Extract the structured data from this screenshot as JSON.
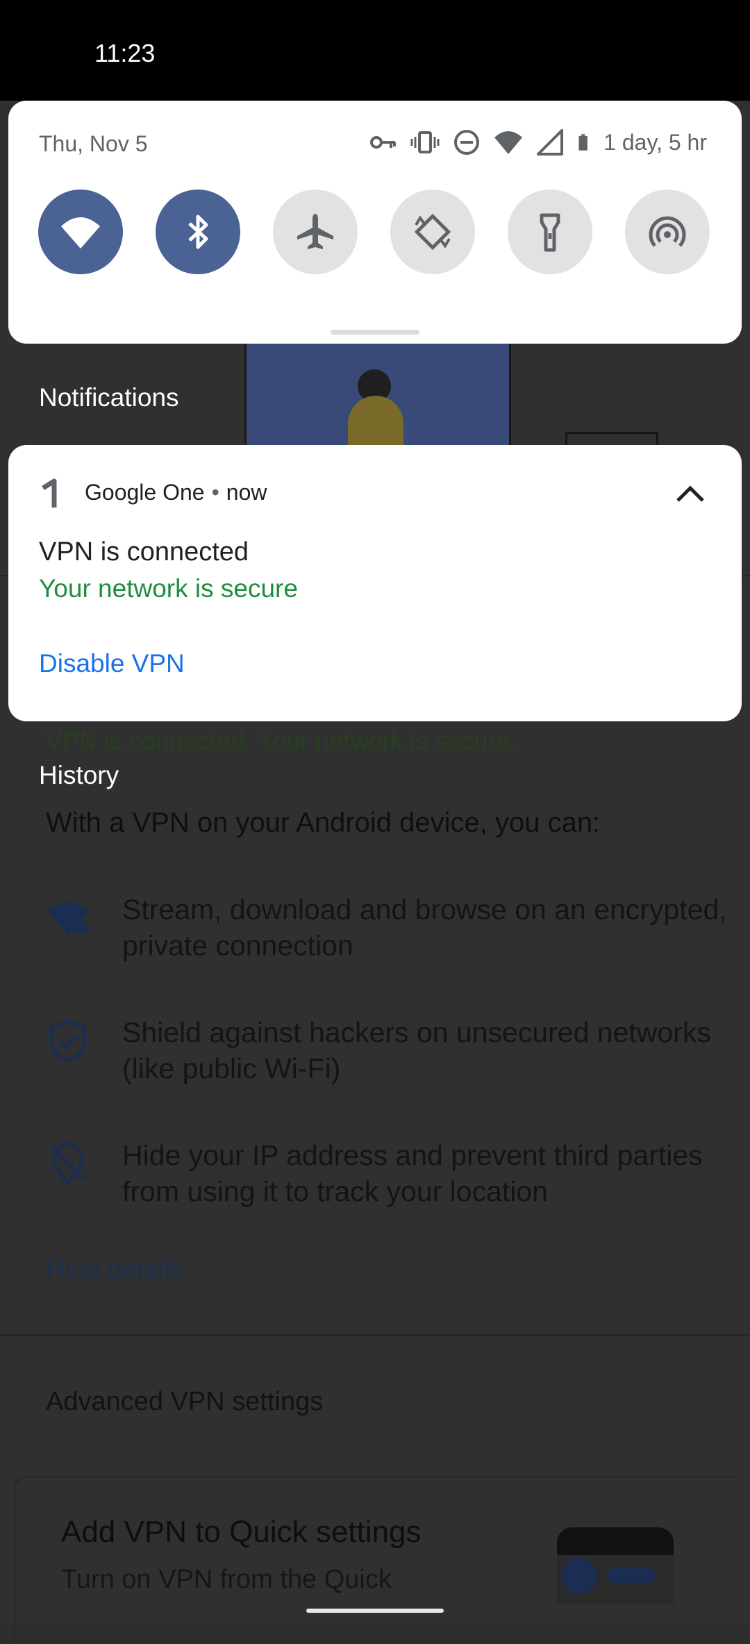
{
  "status_bar": {
    "time": "11:23"
  },
  "quick_settings": {
    "date": "Thu, Nov 5",
    "battery_text": "1 day, 5 hr",
    "status_icons": [
      "vpn-key-icon",
      "vibrate-icon",
      "do-not-disturb-icon",
      "wifi-signal-icon",
      "cell-signal-icon",
      "battery-icon"
    ],
    "tiles": [
      {
        "name": "wifi",
        "icon": "wifi-icon",
        "state": "on"
      },
      {
        "name": "bluetooth",
        "icon": "bluetooth-icon",
        "state": "on"
      },
      {
        "name": "airplane-mode",
        "icon": "airplane-icon",
        "state": "off"
      },
      {
        "name": "auto-rotate",
        "icon": "rotate-icon",
        "state": "off"
      },
      {
        "name": "flashlight",
        "icon": "flashlight-icon",
        "state": "off"
      },
      {
        "name": "hotspot",
        "icon": "hotspot-icon",
        "state": "off"
      }
    ]
  },
  "sections": {
    "notifications": "Notifications",
    "history": "History"
  },
  "notification": {
    "app_name": "Google One",
    "separator": "•",
    "time": "now",
    "title": "VPN is connected",
    "text": "Your network is secure",
    "action": "Disable VPN"
  },
  "background_app": {
    "status": "VPN is connected. Your network is secure.",
    "intro": "With a VPN on your Android device, you can:",
    "features": [
      {
        "icon": "wifi-lock-icon",
        "text": "Stream, download and browse on an encrypted, private connection"
      },
      {
        "icon": "shield-check-icon",
        "text": "Shield against hackers on unsecured networks (like public Wi-Fi)"
      },
      {
        "icon": "location-off-icon",
        "text": "Hide your IP address and prevent third parties from using it to track your location"
      }
    ],
    "hide_details": "Hide details",
    "advanced_settings": "Advanced VPN settings",
    "card_title": "Add VPN to Quick settings",
    "card_subtitle": "Turn on VPN from the Quick"
  },
  "colors": {
    "tile_on": "#4a6294",
    "tile_off": "#e2e2e2",
    "secure_green": "#1e8e3e",
    "action_blue": "#1a73e8"
  }
}
